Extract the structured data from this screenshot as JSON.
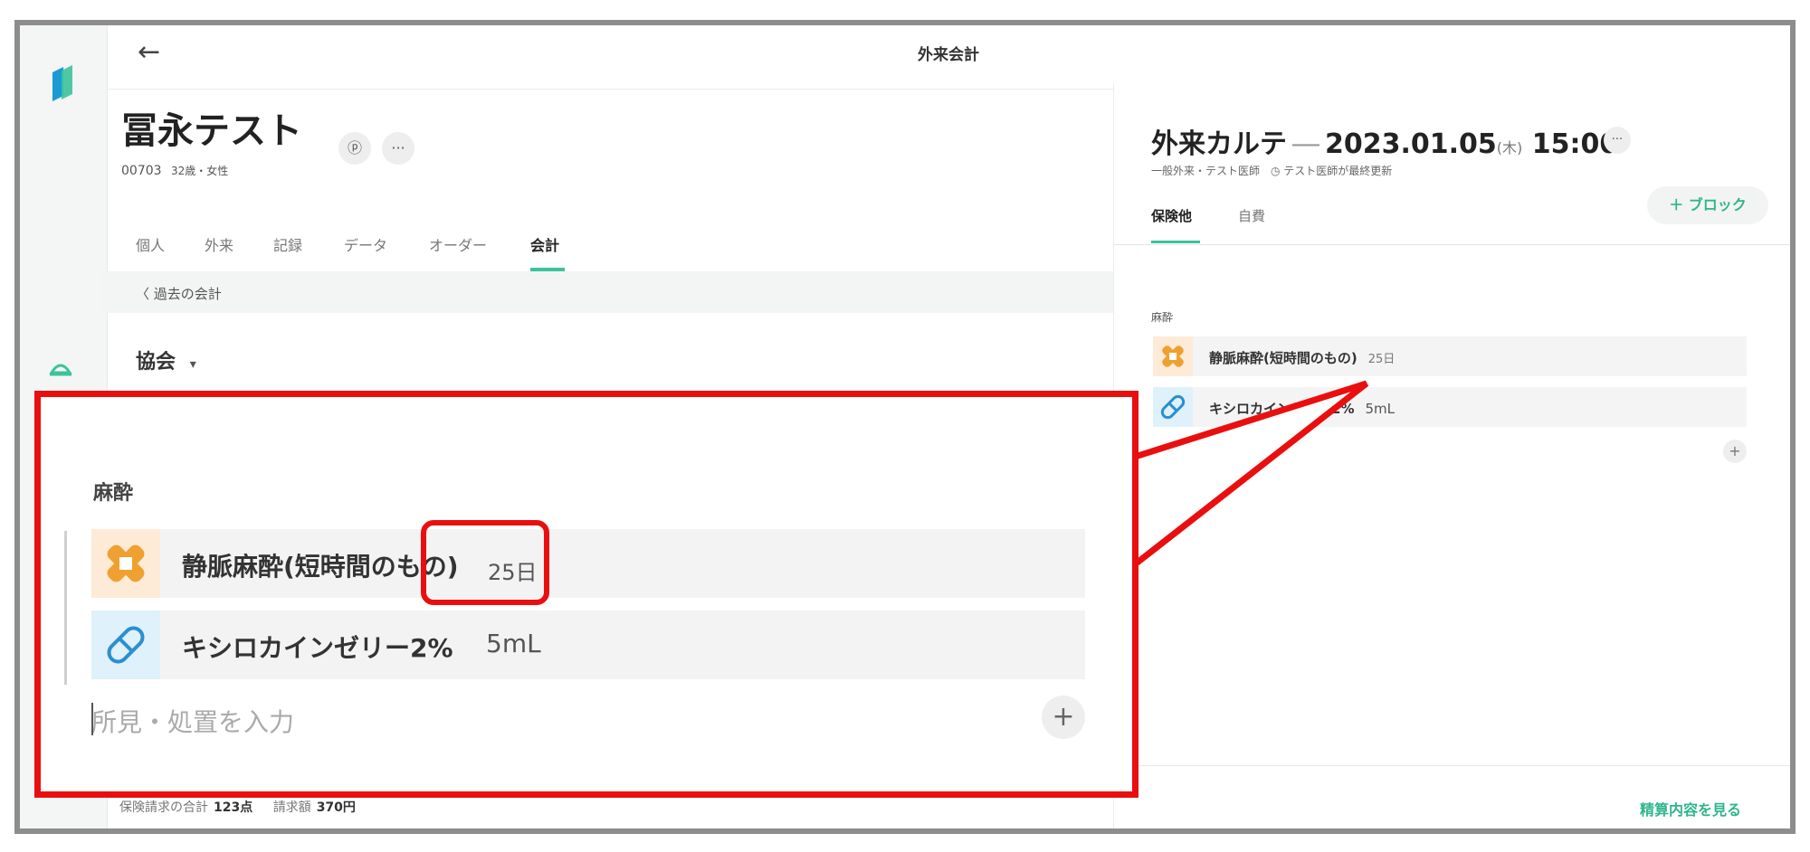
{
  "header": {
    "title": "外来会計",
    "back_icon": "←"
  },
  "patient": {
    "name": "冨永テスト",
    "id": "00703",
    "age_sex": "32歳・女性",
    "more_label": "···",
    "comment_label": "ⓟ"
  },
  "tabs": [
    {
      "label": "個人"
    },
    {
      "label": "外来"
    },
    {
      "label": "記録"
    },
    {
      "label": "データ"
    },
    {
      "label": "オーダー"
    },
    {
      "label": "会計",
      "active": true
    }
  ],
  "past_link": "〈 過去の会計",
  "insurer_select": {
    "value": "協会",
    "caret": "▾"
  },
  "footer_left": {
    "insurance_label": "保険請求の合計",
    "insurance_value": "123点",
    "billing_label": "請求額",
    "billing_value": "370円"
  },
  "chart": {
    "title": "外来カルテ",
    "dash": "―",
    "date": "2023.01.05",
    "weekday": "(木)",
    "time": "15:00",
    "more": "···",
    "subtitle": "一般外来・テスト医師　◷ テスト医師が最終更新",
    "tabs": [
      {
        "label": "保険他",
        "active": true
      },
      {
        "label": "自費"
      }
    ],
    "block_button": "＋ ブロック",
    "section": "麻酔",
    "items": [
      {
        "name": "静脈麻酔(短時間のもの)",
        "qty": "25日",
        "icon": "bandage-icon",
        "color": "#f0a030"
      },
      {
        "name": "キシロカインゼリー2%",
        "qty": "5mL",
        "icon": "pill-icon",
        "color": "#2b8fd1"
      }
    ],
    "input_placeholder": "所見・処置を入力",
    "add_label": "+",
    "detail_link": "精算内容を見る"
  },
  "zoom": {
    "section": "麻酔",
    "items": [
      {
        "name": "静脈麻酔(短時間のもの)",
        "qty": "25日"
      },
      {
        "name": "キシロカインゼリー2%",
        "qty": "5mL"
      }
    ],
    "input_placeholder": "所見・処置を入力",
    "add_label": "+"
  },
  "colors": {
    "accent": "#3cc39b",
    "highlight": "#ea0f0f",
    "frame": "#8d8d8d"
  }
}
